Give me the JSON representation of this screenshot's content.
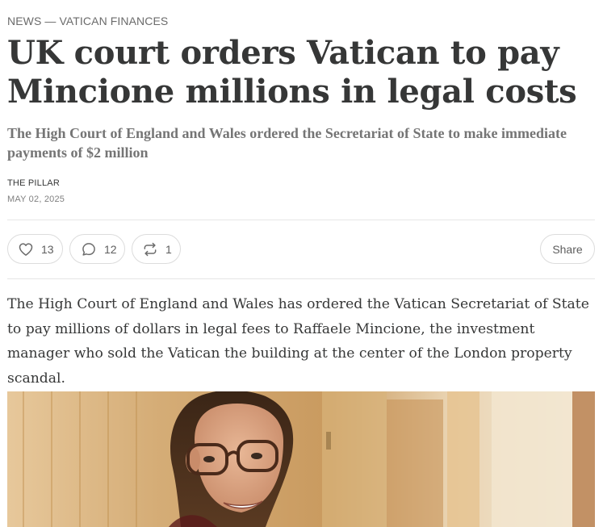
{
  "article": {
    "section_label": "NEWS — VATICAN FINANCES",
    "headline": "UK court orders Vatican to pay Mincione millions in legal costs",
    "subtitle": "The High Court of England and Wales ordered the Secretariat of State to make immediate payments of $2 million",
    "author": "THE PILLAR",
    "date": "MAY 02, 2025",
    "body": "The High Court of England and Wales has ordered the Vatican Secretariat of State to pay millions of dollars in legal fees to Raffaele Mincione, the investment manager who sold the Vatican the building at the center of the London property scandal."
  },
  "actions": {
    "like_count": "13",
    "like_icon": "heart-icon",
    "comment_count": "12",
    "comment_icon": "comment-bubble-icon",
    "restack_count": "1",
    "restack_icon": "restack-arrows-icon",
    "share_label": "Share"
  },
  "photo": {
    "subject": "man-with-glasses"
  }
}
